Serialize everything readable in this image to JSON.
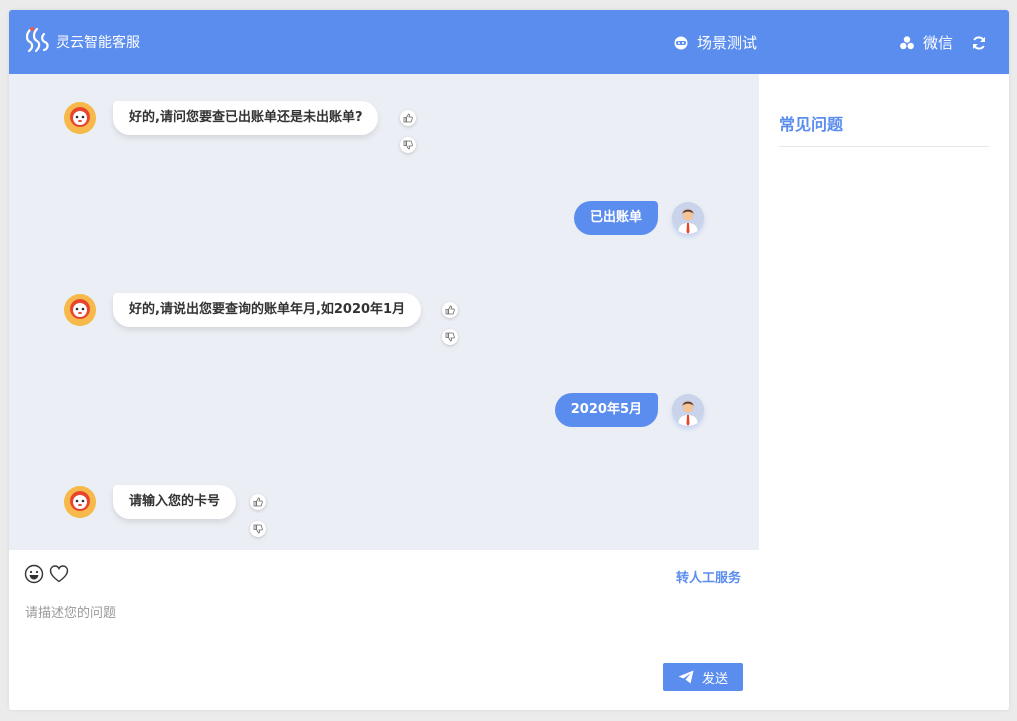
{
  "header": {
    "app_title": "灵云智能客服",
    "scene_label": "场景测试",
    "wechat_label": "微信"
  },
  "messages": [
    {
      "sender": "bot",
      "text": "好的,请问您要查已出账单还是未出账单?"
    },
    {
      "sender": "user",
      "text": "已出账单"
    },
    {
      "sender": "bot",
      "text": "好的,请说出您要查询的账单年月,如2020年1月"
    },
    {
      "sender": "user",
      "text": "2020年5月"
    },
    {
      "sender": "bot",
      "text": "请输入您的卡号"
    }
  ],
  "toolbar": {
    "transfer_label": "转人工服务"
  },
  "input": {
    "placeholder": "请描述您的问题",
    "value": ""
  },
  "send": {
    "label": "发送"
  },
  "sidebar": {
    "faq_title": "常见问题"
  },
  "colors": {
    "accent": "#5b8def",
    "chat_bg": "#ebeef4"
  },
  "icons": {
    "logo": "lingyun-logo-icon",
    "scene": "robot-icon",
    "wechat": "wechat-icon",
    "refresh": "refresh-icon",
    "emoji": "smile-icon",
    "favorite": "heart-icon",
    "send": "paper-plane-icon",
    "like": "thumbs-up-icon",
    "dislike": "thumbs-down-icon"
  }
}
